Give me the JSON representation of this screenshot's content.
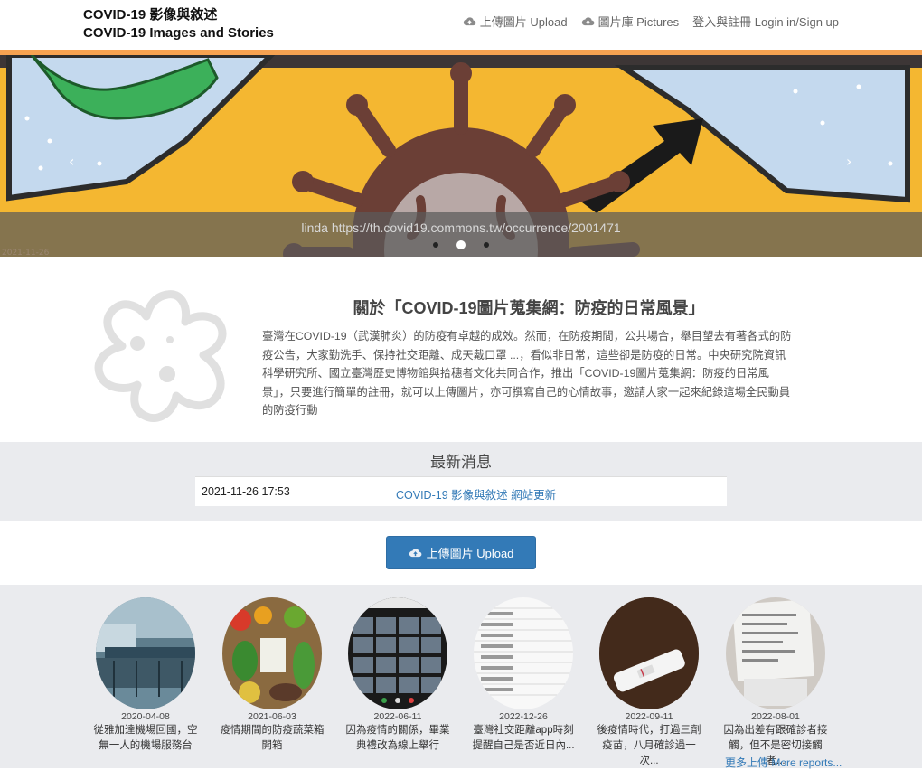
{
  "header": {
    "title_zh": "COVID-19 影像與敘述",
    "title_en": "COVID-19 Images and Stories",
    "nav": [
      {
        "label": "上傳圖片 Upload",
        "icon": "cloud-upload-icon"
      },
      {
        "label": "圖片庫 Pictures",
        "icon": "cloud-upload-icon"
      },
      {
        "label": "登入與註冊 Login in/Sign up"
      }
    ]
  },
  "colors": {
    "accent_bar": "#f6a251",
    "link": "#337ab7",
    "button": "#337ab7",
    "section_bg": "#eaebee"
  },
  "carousel": {
    "caption": "linda https://th.covid19.commons.tw/occurrence/2001471",
    "prev_icon": "chevron-left-icon",
    "next_icon": "chevron-right-icon",
    "slide_count": 3,
    "active_slide": 2,
    "photo_date": "2021-11-26"
  },
  "about": {
    "title": "關於「COVID-19圖片蒐集網：防疫的日常風景」",
    "body": "臺灣在COVID-19（武漢肺炎）的防疫有卓越的成效。然而，在防疫期間，公共場合，舉目望去有著各式的防疫公告，大家勤洗手、保持社交距離、成天戴口罩 ...，看似非日常，這些卻是防疫的日常。中央研究院資訊科學研究所、國立臺灣歷史博物館與拾穗者文化共同合作，推出「COVID-19圖片蒐集網：防疫的日常風景」，只要進行簡單的註冊，就可以上傳圖片，亦可撰寫自己的心情故事，邀請大家一起來紀錄這場全民動員的防疫行動"
  },
  "news": {
    "heading": "最新消息",
    "items": [
      {
        "date": "2021-11-26 17:53",
        "title": "COVID-19 影像與敘述 網站更新"
      }
    ]
  },
  "upload_button": {
    "label": "上傳圖片 Upload"
  },
  "gallery": {
    "items": [
      {
        "date": "2020-04-08",
        "caption": "從雅加達機場回國，空無一人的機場服務台"
      },
      {
        "date": "2021-06-03",
        "caption": "疫情期間的防疫蔬菜箱開箱"
      },
      {
        "date": "2022-06-11",
        "caption": "因為疫情的關係，畢業典禮改為線上舉行"
      },
      {
        "date": "2022-12-26",
        "caption": "臺灣社交距離app時刻提醒自己是否近日內..."
      },
      {
        "date": "2022-09-11",
        "caption": "後疫情時代，打過三劑疫苗，八月確診過一次..."
      },
      {
        "date": "2022-08-01",
        "caption": "因為出差有跟確診者接觸，但不是密切接觸者..."
      }
    ],
    "more_label": "更多上傳 More reports..."
  }
}
